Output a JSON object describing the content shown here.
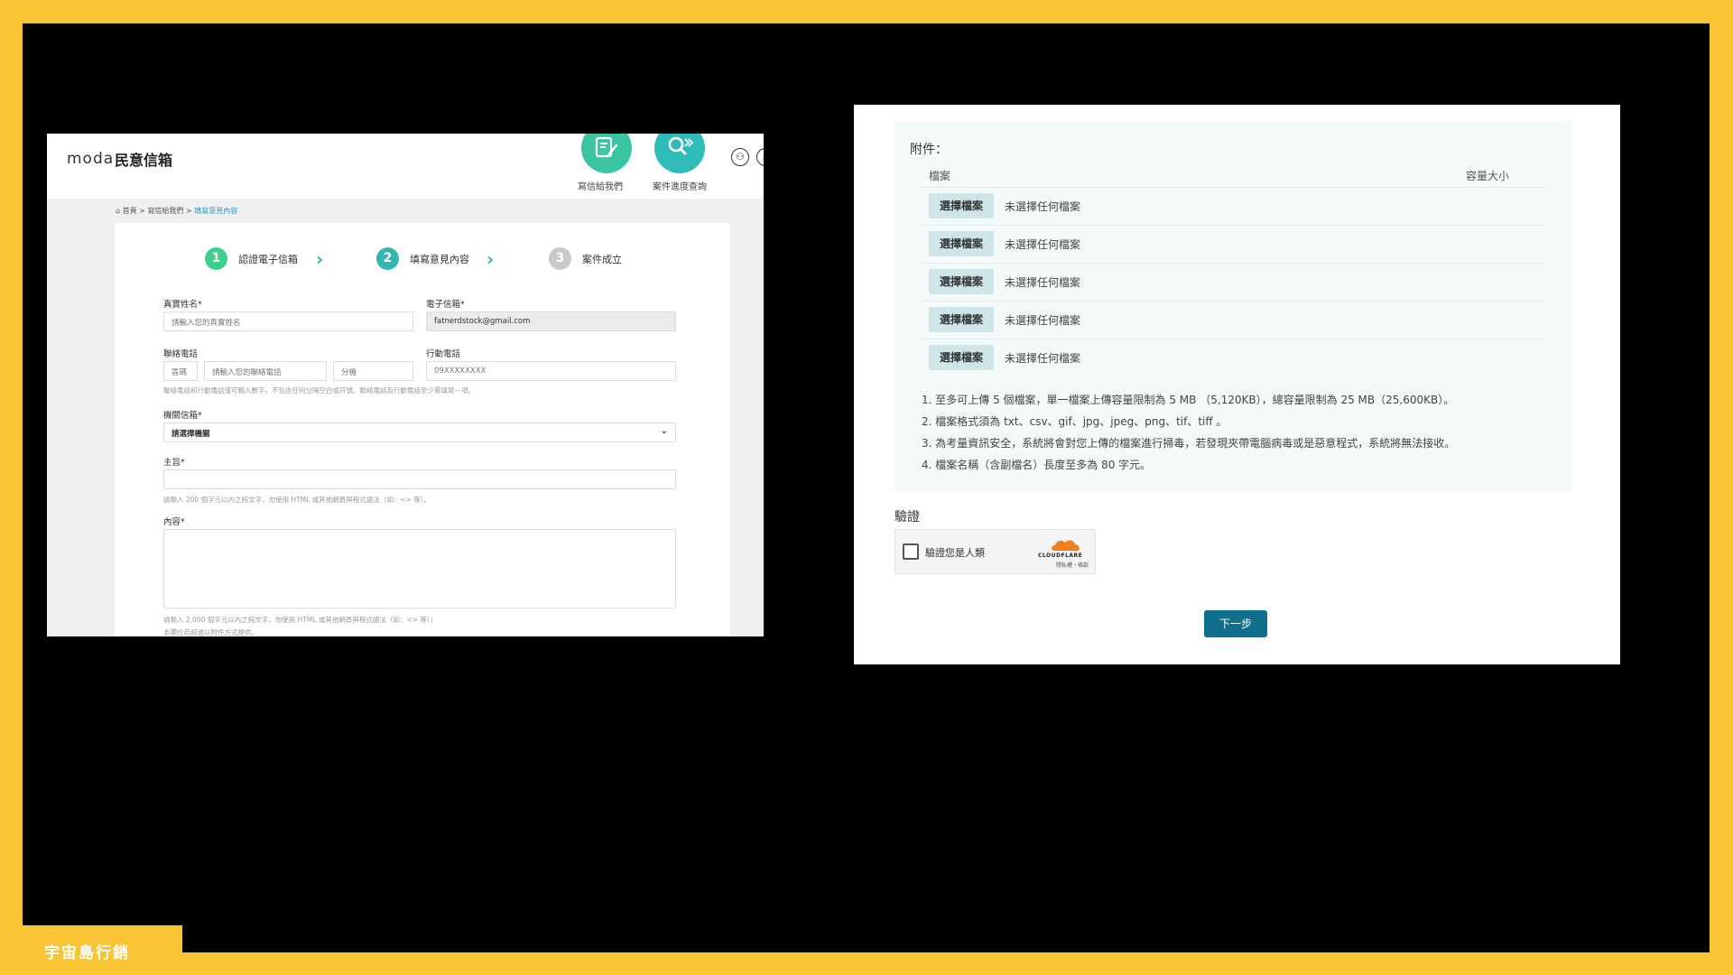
{
  "brand": {
    "name": "宇宙島行銷"
  },
  "left": {
    "logo": "moda",
    "title": "民意信箱",
    "nav": [
      {
        "label": "寫信給我們"
      },
      {
        "label": "案件進度查詢"
      }
    ],
    "breadcrumbs": {
      "home": "首頁",
      "sep1": ">",
      "mid": "寫信給我們",
      "sep2": ">",
      "current": "填寫意見內容"
    },
    "steps": [
      {
        "num": "1",
        "label": "認證電子信箱",
        "color": "#3ccf8e"
      },
      {
        "num": "2",
        "label": "填寫意見內容",
        "color": "#35b7b0"
      },
      {
        "num": "3",
        "label": "案件成立",
        "color": "#c9c9c9"
      }
    ],
    "form": {
      "name_label": "真實姓名*",
      "name_placeholder": "請輸入您的真實姓名",
      "email_label": "電子信箱*",
      "email_value": "fatnerdstock@gmail.com",
      "phone_label": "聯絡電話",
      "area_placeholder": "區碼",
      "phone_placeholder": "請輸入您的聯絡電話",
      "ext_placeholder": "分機",
      "mobile_label": "行動電話",
      "mobile_placeholder": "09XXXXXXXX",
      "phone_hint": "聯絡電話和行動電話僅可輸入數字，不包含任何分隔空白或符號。聯絡電話及行動電話至少需填寫一項。",
      "agency_label": "機關信箱*",
      "agency_value": "請選擇機關",
      "subject_label": "主旨*",
      "subject_hint": "請輸入 200 個字元以內之純文字，勿使用 HTML 或其他網頁與程式語法（如：<> 等）。",
      "content_label": "內容*",
      "content_hint": "請輸入 2,000 個字元以內之純文字，勿使用 HTML 或其他網頁與程式語法（如：<> 等）；",
      "content_hint2": "本欄位若超過以附件方式提供。"
    }
  },
  "right": {
    "attachments_title": "附件：",
    "col_file": "檔案",
    "col_size": "容量大小",
    "files": [
      {
        "button": "選擇檔案",
        "status": "未選擇任何檔案"
      },
      {
        "button": "選擇檔案",
        "status": "未選擇任何檔案"
      },
      {
        "button": "選擇檔案",
        "status": "未選擇任何檔案"
      },
      {
        "button": "選擇檔案",
        "status": "未選擇任何檔案"
      },
      {
        "button": "選擇檔案",
        "status": "未選擇任何檔案"
      }
    ],
    "notes": [
      "1. 至多可上傳 5 個檔案，單一檔案上傳容量限制為 5 MB （5,120KB），總容量限制為 25 MB（25,600KB）。",
      "2. 檔案格式須為 txt、csv、gif、jpg、jpeg、png、tif、tiff 。",
      "3. 為考量資訊安全，系統將會對您上傳的檔案進行掃毒，若發現夾帶電腦病毒或是惡意程式，系統將無法接收。",
      "4. 檔案名稱（含副檔名）長度至多為 80 字元。"
    ],
    "verify_title": "驗證",
    "captcha_label": "驗證您是人類",
    "captcha_brand": "CLOUDFLARE",
    "captcha_sub": "隱私權・條款",
    "next_button": "下一步"
  }
}
